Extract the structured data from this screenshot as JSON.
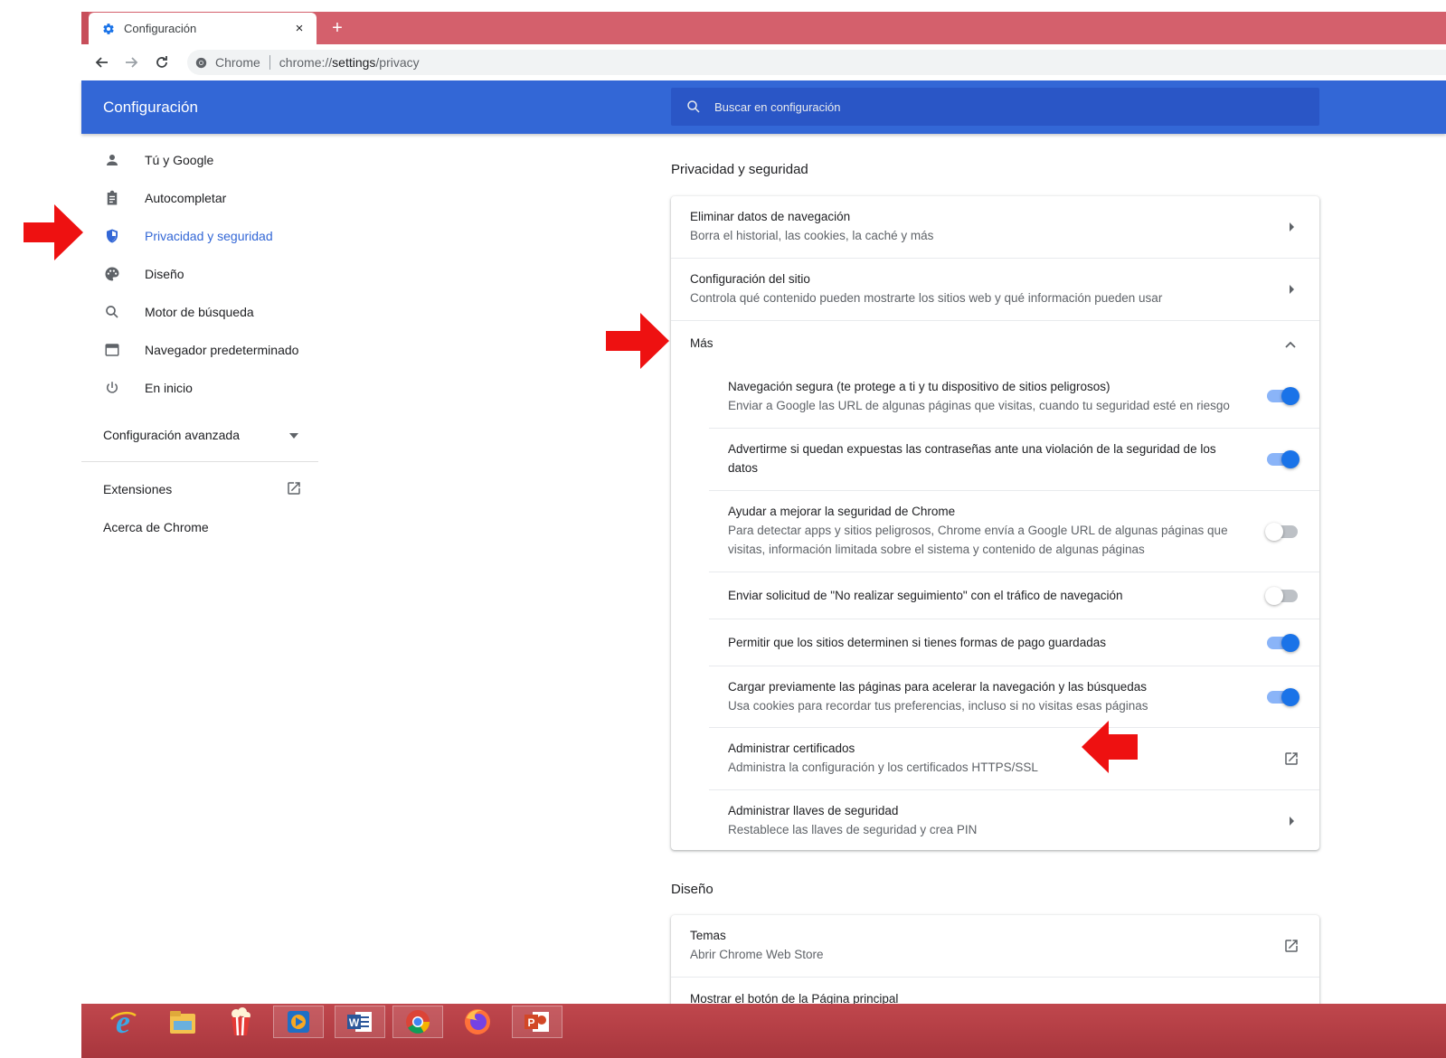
{
  "browser": {
    "tab_title": "Configuración",
    "close_glyph": "×",
    "newtab_glyph": "+",
    "omnibox_site": "Chrome",
    "omnibox_url_prefix": "chrome://",
    "omnibox_url_bold": "settings",
    "omnibox_url_suffix": "/privacy",
    "accent_color": "#d4606c"
  },
  "header": {
    "title": "Configuración",
    "search_placeholder": "Buscar en configuración",
    "color": "#3367d6"
  },
  "sidebar": {
    "items": [
      {
        "label": "Tú y Google",
        "icon": "person-icon"
      },
      {
        "label": "Autocompletar",
        "icon": "clipboard-icon"
      },
      {
        "label": "Privacidad y seguridad",
        "icon": "shield-icon",
        "active": true
      },
      {
        "label": "Diseño",
        "icon": "palette-icon"
      },
      {
        "label": "Motor de búsqueda",
        "icon": "search-icon"
      },
      {
        "label": "Navegador predeterminado",
        "icon": "browser-window-icon"
      },
      {
        "label": "En inicio",
        "icon": "power-icon"
      }
    ],
    "advanced": "Configuración avanzada",
    "extensions": "Extensiones",
    "about": "Acerca de Chrome"
  },
  "privacy": {
    "section_title": "Privacidad y seguridad",
    "clear_data": {
      "title": "Eliminar datos de navegación",
      "desc": "Borra el historial, las cookies, la caché y más"
    },
    "site_settings": {
      "title": "Configuración del sitio",
      "desc": "Controla qué contenido pueden mostrarte los sitios web y qué información pueden usar"
    },
    "more_label": "Más",
    "safe_browsing": {
      "title": "Navegación segura (te protege a ti y tu dispositivo de sitios peligrosos)",
      "desc": "Enviar a Google las URL de algunas páginas que visitas, cuando tu seguridad esté en riesgo",
      "enabled": true
    },
    "password_leak": {
      "title": "Advertirme si quedan expuestas las contraseñas ante una violación de la seguridad de los datos",
      "enabled": true
    },
    "improve_security": {
      "title": "Ayudar a mejorar la seguridad de Chrome",
      "desc": "Para detectar apps y sitios peligrosos, Chrome envía a Google URL de algunas páginas que visitas, información limitada sobre el sistema y contenido de algunas páginas",
      "enabled": false
    },
    "do_not_track": {
      "title": "Enviar solicitud de \"No realizar seguimiento\" con el tráfico de navegación",
      "enabled": false
    },
    "payment_methods": {
      "title": "Permitir que los sitios determinen si tienes formas de pago guardadas",
      "enabled": true
    },
    "preload": {
      "title": "Cargar previamente las páginas para acelerar la navegación y las búsquedas",
      "desc": "Usa cookies para recordar tus preferencias, incluso si no visitas esas páginas",
      "enabled": true
    },
    "certificates": {
      "title": "Administrar certificados",
      "desc": "Administra la configuración y los certificados HTTPS/SSL"
    },
    "security_keys": {
      "title": "Administrar llaves de seguridad",
      "desc": "Restablece las llaves de seguridad y crea PIN"
    }
  },
  "appearance": {
    "section_title": "Diseño",
    "themes": {
      "title": "Temas",
      "desc": "Abrir Chrome Web Store"
    },
    "home_button": {
      "title": "Mostrar el botón de la Página principal"
    }
  },
  "taskbar": {
    "apps": [
      "internet-explorer-icon",
      "file-explorer-icon",
      "popcorn-icon",
      "media-player-icon",
      "word-icon",
      "chrome-icon",
      "firefox-icon",
      "powerpoint-icon"
    ]
  },
  "annotation_color": "#ee1111"
}
